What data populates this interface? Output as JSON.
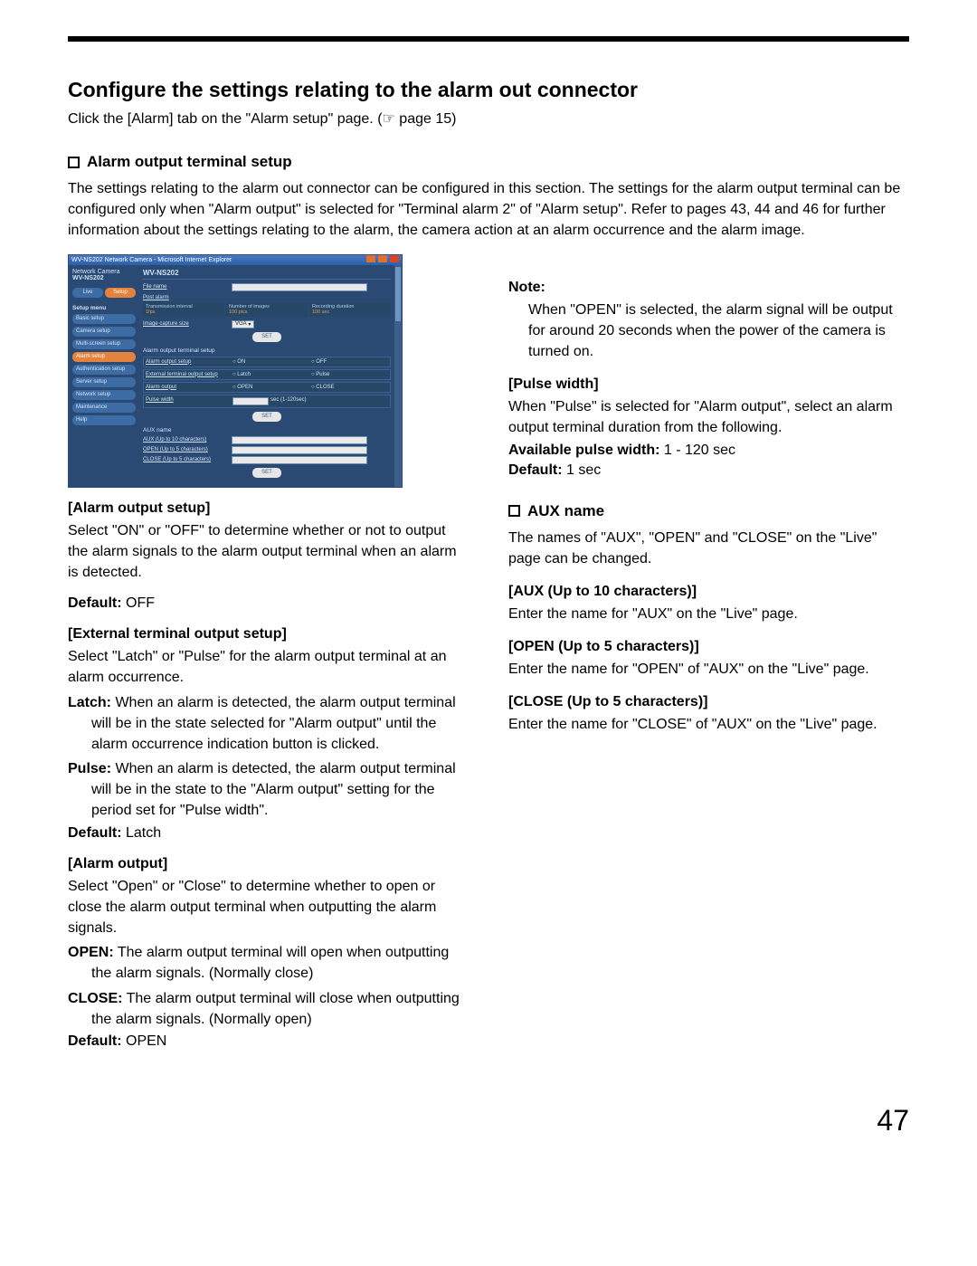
{
  "title": "Configure the settings relating to the alarm out connector",
  "intro": "Click the [Alarm] tab on the \"Alarm setup\" page. (☞ page 15)",
  "alarm_terminal": {
    "heading": "Alarm output terminal setup",
    "paragraph": "The settings relating to the alarm out connector can be configured in this section. The settings for the alarm output terminal can be configured only when \"Alarm output\" is selected for \"Terminal alarm 2\" of \"Alarm setup\". Refer to pages 43, 44 and 46 for further information about the settings relating to the alarm, the camera action at an alarm occurrence and the alarm image."
  },
  "screenshot": {
    "window_title": "WV-NS202 Network Camera - Microsoft Internet Explorer",
    "brand_line": "Network Camera",
    "model": "WV-NS202",
    "tabs": {
      "live": "Live",
      "setup": "Setup"
    },
    "setup_menu_label": "Setup menu",
    "side_items": [
      "Basic setup",
      "Camera setup",
      "Multi-screen setup",
      "Alarm setup",
      "Authentication setup",
      "Server setup",
      "Network setup",
      "Maintenance",
      "Help"
    ],
    "active_side": "Alarm setup",
    "file_name": "File name",
    "post_alarm": "Post alarm",
    "tx_interval": "Transmission interval",
    "tx_value": "1fps",
    "num_images": "Number of images",
    "num_images_val": "100 pics",
    "rec_duration": "Recording duration",
    "rec_duration_val": "100 sec",
    "capture_size": "Image capture size",
    "capture_value": "VGA",
    "set": "SET",
    "aots_heading": "Alarm output terminal setup",
    "row_alarm_output_setup": "Alarm output setup",
    "row_ext_terminal": "External terminal output setup",
    "row_alarm_output": "Alarm output",
    "row_pulse_width": "Pulse width",
    "on": "ON",
    "off": "OFF",
    "latch": "Latch",
    "pulse": "Pulse",
    "open": "OPEN",
    "close": "CLOSE",
    "pw_range": "sec (1-120sec)",
    "aux_heading": "AUX name",
    "aux10": "AUX (Up to 10 characters)",
    "open5": "OPEN (Up to 5 characters)",
    "close5": "CLOSE (Up to 5 characters)"
  },
  "left_col": {
    "alarm_output_setup": {
      "label": "[Alarm output setup]",
      "body": "Select \"ON\" or \"OFF\" to determine whether or not to output the alarm signals to the alarm output terminal when an alarm is detected.",
      "default": "Default: OFF"
    },
    "ext_terminal": {
      "label": "[External terminal output setup]",
      "body": "Select \"Latch\" or \"Pulse\" for the alarm output terminal at an alarm occurrence.",
      "latch": "Latch: When an alarm is detected, the alarm output terminal will be in the state selected for \"Alarm output\" until the alarm occurrence indication button is clicked.",
      "pulse": "Pulse: When an alarm is detected, the alarm output terminal will be in the state to the \"Alarm output\" setting for the period set for \"Pulse width\".",
      "default": "Default: Latch"
    },
    "alarm_output": {
      "label": "[Alarm output]",
      "body": "Select \"Open\" or \"Close\" to determine whether to open or close the alarm output terminal when outputting the alarm signals.",
      "open": "OPEN: The alarm output terminal will open when outputting the alarm signals. (Normally close)",
      "close": "CLOSE: The alarm output terminal will close when outputting the alarm signals. (Normally open)",
      "default": "Default: OPEN"
    }
  },
  "right_col": {
    "note_label": "Note:",
    "note_body": "When \"OPEN\" is selected, the alarm signal will be output for around 20 seconds when the power of the camera is turned on.",
    "pulse_width": {
      "label": "[Pulse width]",
      "body": "When \"Pulse\" is selected for \"Alarm output\", select an alarm output terminal duration from the following.",
      "avail": "Available pulse width: 1 - 120 sec",
      "default": "Default: 1 sec"
    },
    "aux_name": {
      "heading": "AUX name",
      "body": "The names of \"AUX\", \"OPEN\" and \"CLOSE\" on the \"Live\" page can be changed.",
      "aux10": {
        "label": "[AUX (Up to 10 characters)]",
        "body": "Enter the name for \"AUX\" on the \"Live\" page."
      },
      "open5": {
        "label": "[OPEN (Up to 5 characters)]",
        "body": "Enter the name for \"OPEN\" of \"AUX\" on the \"Live\" page."
      },
      "close5": {
        "label": "[CLOSE (Up to 5 characters)]",
        "body": "Enter the name for \"CLOSE\" of \"AUX\" on the \"Live\" page."
      }
    }
  },
  "page_number": "47"
}
